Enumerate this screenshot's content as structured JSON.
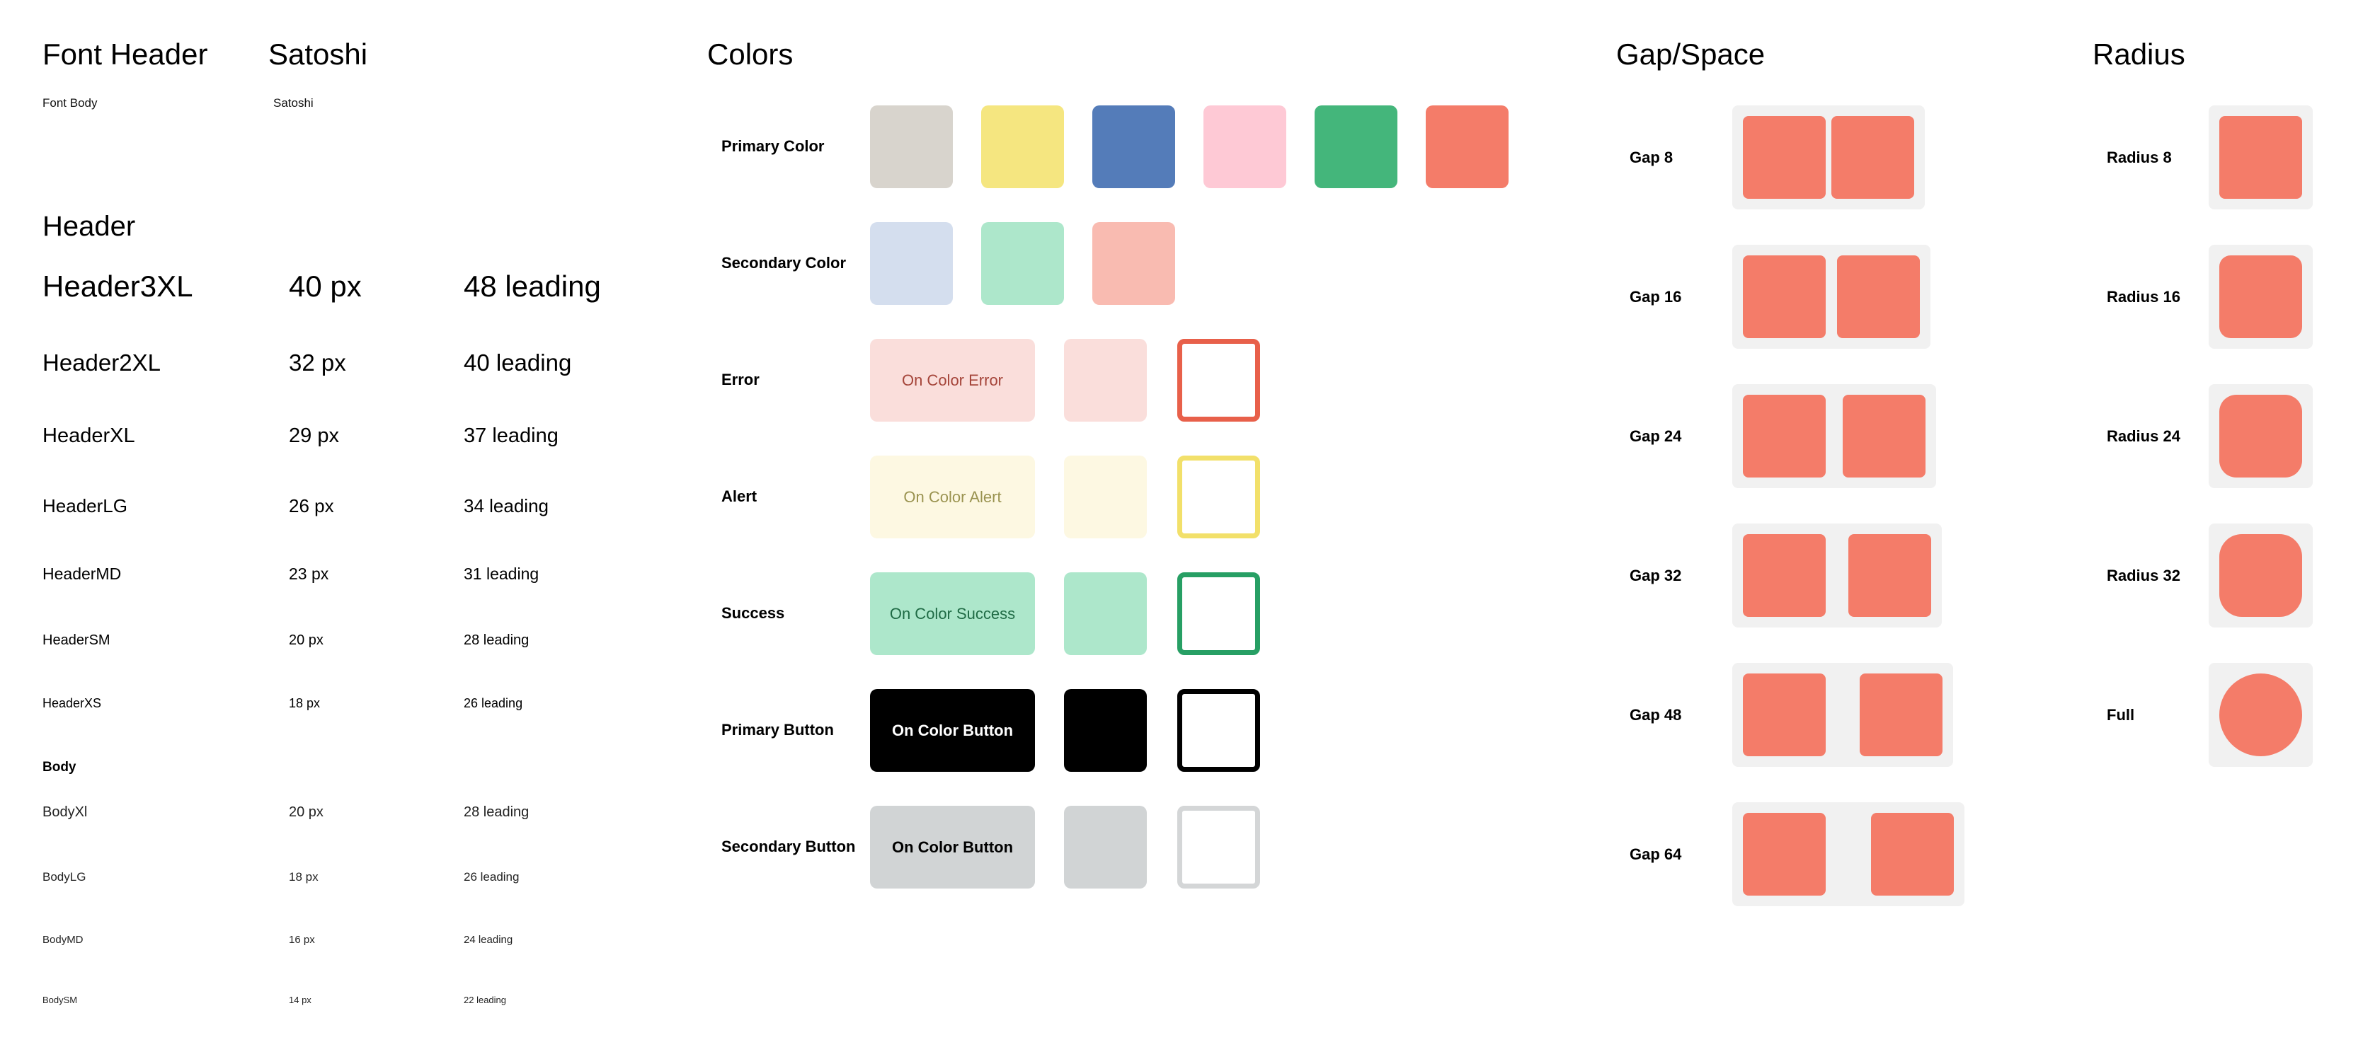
{
  "fonts": {
    "header_label": "Font Header",
    "header_value": "Satoshi",
    "body_label": "Font Body",
    "body_value": "Satoshi"
  },
  "typography": {
    "header_title": "Header",
    "headers": [
      {
        "name": "Header3XL",
        "size": "40 px",
        "leading": "48 leading"
      },
      {
        "name": "Header2XL",
        "size": "32 px",
        "leading": "40 leading"
      },
      {
        "name": "HeaderXL",
        "size": "29 px",
        "leading": "37 leading"
      },
      {
        "name": "HeaderLG",
        "size": "26 px",
        "leading": "34 leading"
      },
      {
        "name": "HeaderMD",
        "size": "23 px",
        "leading": "31 leading"
      },
      {
        "name": "HeaderSM",
        "size": "20 px",
        "leading": "28 leading"
      },
      {
        "name": "HeaderXS",
        "size": "18 px",
        "leading": "26 leading"
      }
    ],
    "body_title": "Body",
    "bodies": [
      {
        "name": "BodyXl",
        "size": "20 px",
        "leading": "28 leading"
      },
      {
        "name": "BodyLG",
        "size": "18 px",
        "leading": "26 leading"
      },
      {
        "name": "BodyMD",
        "size": "16 px",
        "leading": "24 leading"
      },
      {
        "name": "BodySM",
        "size": "14 px",
        "leading": "22 leading"
      }
    ]
  },
  "colors": {
    "title": "Colors",
    "primary": {
      "label": "Primary Color",
      "swatches": [
        "#d8d4cd",
        "#f5e680",
        "#547cb9",
        "#fec9d5",
        "#44b67b",
        "#f47c69"
      ]
    },
    "secondary": {
      "label": "Secondary Color",
      "swatches": [
        "#d4deee",
        "#ade7cb",
        "#f9bbb1"
      ]
    },
    "states": [
      {
        "label": "Error",
        "on_text": "On Color Error",
        "bg": "#fadedb",
        "text": "#a5453a",
        "border": "#e8604a"
      },
      {
        "label": "Alert",
        "on_text": "On Color Alert",
        "bg": "#fdf8e2",
        "text": "#9a9350",
        "border": "#f2e06a"
      },
      {
        "label": "Success",
        "on_text": "On Color Success",
        "bg": "#ade7cb",
        "text": "#1f6b45",
        "border": "#279f64"
      },
      {
        "label": "Primary Button",
        "on_text": "On Color Button",
        "bg": "#000000",
        "text": "#ffffff",
        "border": "#000000"
      },
      {
        "label": "Secondary Button",
        "on_text": "On Color Button",
        "bg": "#d1d4d5",
        "text": "#000000",
        "border": "#d4d6d7"
      }
    ]
  },
  "gap": {
    "title": "Gap/Space",
    "items": [
      {
        "label": "Gap 8",
        "gap": 8
      },
      {
        "label": "Gap 16",
        "gap": 16
      },
      {
        "label": "Gap 24",
        "gap": 24
      },
      {
        "label": "Gap 32",
        "gap": 32
      },
      {
        "label": "Gap 48",
        "gap": 48
      },
      {
        "label": "Gap 64",
        "gap": 64
      }
    ],
    "accent": "#f47c69"
  },
  "radius": {
    "title": "Radius",
    "items": [
      {
        "label": "Radius 8",
        "radius": "8"
      },
      {
        "label": "Radius 16",
        "radius": "16"
      },
      {
        "label": "Radius 24",
        "radius": "24"
      },
      {
        "label": "Radius 32",
        "radius": "32"
      },
      {
        "label": "Full",
        "radius": "full"
      }
    ]
  }
}
